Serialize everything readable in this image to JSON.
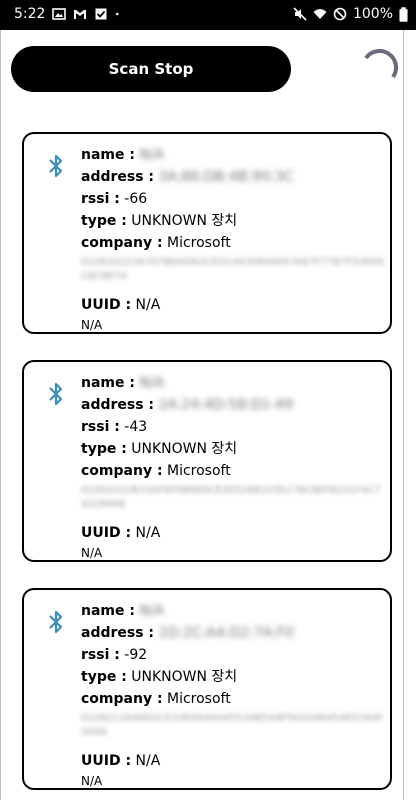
{
  "status_bar": {
    "time": "5:22",
    "battery": "100%",
    "left_icons": [
      "gallery-icon",
      "gmail-icon",
      "check-box-icon",
      "dot-icon"
    ],
    "right_icons": [
      "mute-icon",
      "wifi-icon",
      "do-not-disturb-icon"
    ]
  },
  "scan_button": {
    "label": "Scan Stop"
  },
  "labels": {
    "name": "name :",
    "address": "address :",
    "rssi": "rssi :",
    "type": "type :",
    "company": "company :",
    "uuid": "UUID :"
  },
  "devices": [
    {
      "name": "N/A",
      "address": "3A:86:DB:4B:90:3C",
      "rssi": "-66",
      "type": "UNKNOWN 장치",
      "company": "Microsoft",
      "raw": "010920223A707B6AD62CED1443DE68FA7667F77B7F53000C8C8E74",
      "uuid": "N/A",
      "uuid_detail": "N/A"
    },
    {
      "name": "N/A",
      "address": "2A:24:4D:58:D1:49",
      "rssi": "-43",
      "type": "UNKNOWN 장치",
      "company": "Microsoft",
      "raw": "01092022B33AF0F6B680CE3052681035178C8EF8231F4C79228908",
      "uuid": "N/A",
      "uuid_detail": "N/A"
    },
    {
      "name": "N/A",
      "address": "1D:2C:A4:D2:7A:F0",
      "rssi": "-92",
      "type": "UNKNOWN 장치",
      "company": "Microsoft",
      "raw": "0109212A9602C533ED044445534B544F502D46454E5344F5048",
      "uuid": "N/A",
      "uuid_detail": "N/A"
    }
  ],
  "colors": {
    "accent": "#3a8fb7",
    "button_bg": "#000000",
    "spinner": "#6c6a7a"
  }
}
